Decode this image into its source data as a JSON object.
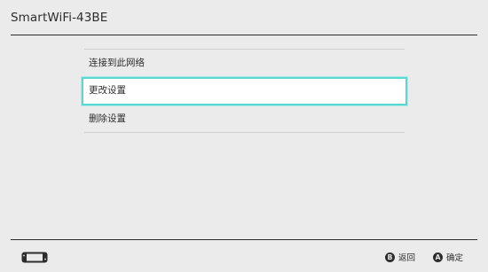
{
  "header": {
    "title": "SmartWiFi-43BE"
  },
  "menu": {
    "items": [
      {
        "label": "连接到此网络",
        "selected": false
      },
      {
        "label": "更改设置",
        "selected": true
      },
      {
        "label": "删除设置",
        "selected": false
      }
    ]
  },
  "footer": {
    "controller_icon": "handheld-console-icon",
    "back": {
      "button": "B",
      "label": "返回"
    },
    "ok": {
      "button": "A",
      "label": "确定"
    }
  },
  "colors": {
    "background": "#ebebeb",
    "selection_border": "#5cd7d1",
    "text": "#2d2d2d"
  }
}
